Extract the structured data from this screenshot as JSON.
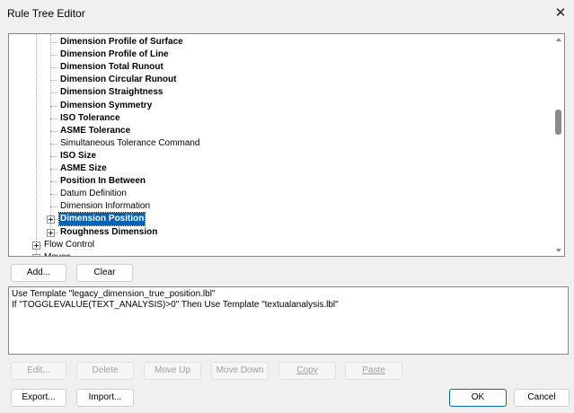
{
  "window": {
    "title": "Rule Tree Editor"
  },
  "tree": {
    "items": [
      {
        "label": "Dimension Profile of Surface",
        "bold": true
      },
      {
        "label": "Dimension Profile of Line",
        "bold": true
      },
      {
        "label": "Dimension Total Runout",
        "bold": true
      },
      {
        "label": "Dimension Circular Runout",
        "bold": true
      },
      {
        "label": "Dimension Straightness",
        "bold": true
      },
      {
        "label": "Dimension Symmetry",
        "bold": true
      },
      {
        "label": "ISO Tolerance",
        "bold": true
      },
      {
        "label": "ASME Tolerance",
        "bold": true
      },
      {
        "label": "Simultaneous Tolerance Command",
        "bold": false
      },
      {
        "label": "ISO Size",
        "bold": true
      },
      {
        "label": "ASME Size",
        "bold": true
      },
      {
        "label": "Position In Between",
        "bold": true
      },
      {
        "label": "Datum Definition",
        "bold": false
      },
      {
        "label": "Dimension Information",
        "bold": false
      },
      {
        "label": "Dimension Position",
        "bold": true,
        "selected": true,
        "expandable": true
      },
      {
        "label": "Roughness Dimension",
        "bold": true,
        "expandable": true
      },
      {
        "label": "Flow Control",
        "bold": false,
        "expandable": true,
        "level": 1
      },
      {
        "label": "Moves",
        "bold": false,
        "expandable": true,
        "level": 1
      }
    ]
  },
  "buttons": {
    "add": "Add...",
    "clear": "Clear",
    "edit": "Edit...",
    "delete": "Delete",
    "move_up": "Move Up",
    "move_down": "Move Down",
    "copy": "Copy",
    "paste": "Paste",
    "export": "Export...",
    "import": "Import...",
    "ok": "OK",
    "cancel": "Cancel"
  },
  "rule_text": {
    "line1": "Use Template \"legacy_dimension_true_position.lbl\"",
    "line2": "If \"TOGGLEVALUE(TEXT_ANALYSIS)>0\" Then Use Template \"textualanalysis.lbl\""
  },
  "colors": {
    "selection": "#0063b1",
    "accent": "#0067c0"
  }
}
